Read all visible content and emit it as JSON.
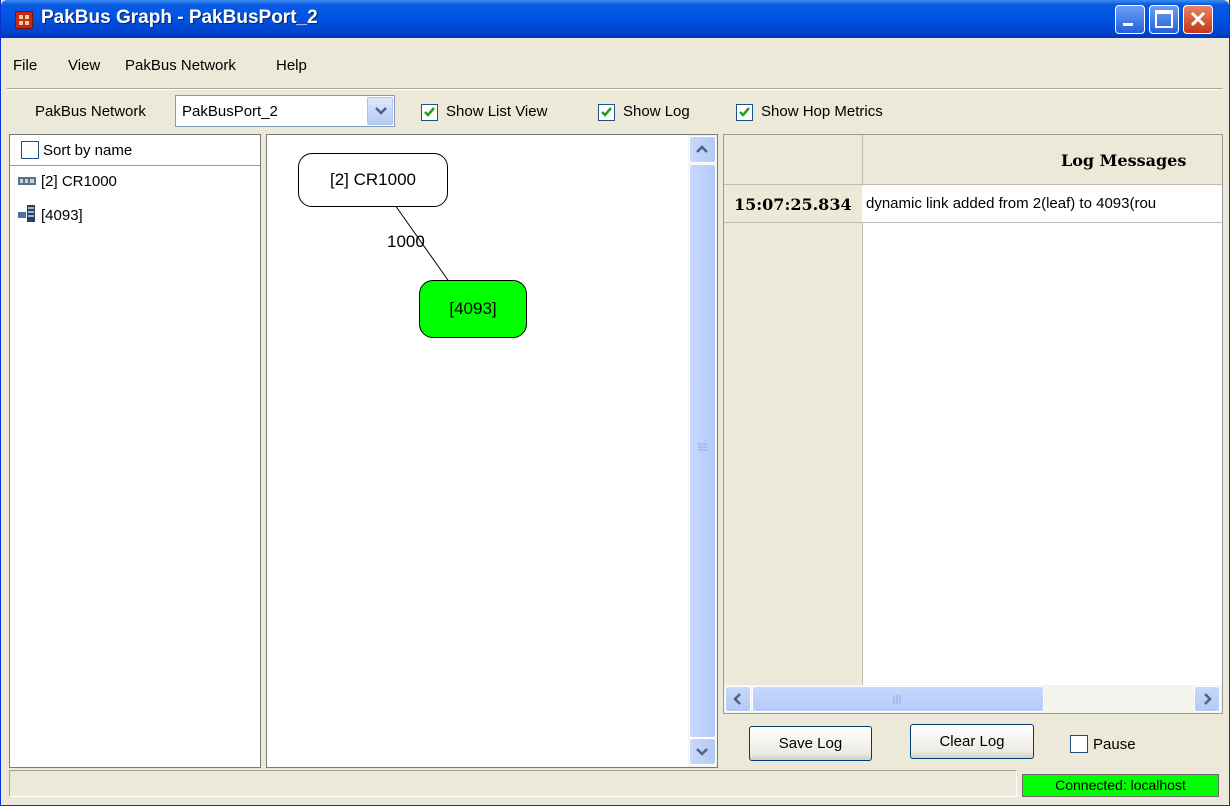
{
  "window": {
    "title": "PakBus Graph - PakBusPort_2"
  },
  "menu": [
    "File",
    "View",
    "PakBus Network",
    "Help"
  ],
  "toolbar": {
    "network_label": "PakBus Network",
    "network_value": "PakBusPort_2",
    "show_list_view": {
      "label": "Show List View",
      "checked": true
    },
    "show_log": {
      "label": "Show Log",
      "checked": true
    },
    "show_hop_metrics": {
      "label": "Show Hop Metrics",
      "checked": true
    }
  },
  "list_view": {
    "sort_by_name": {
      "label": "Sort by name",
      "checked": false
    },
    "items": [
      {
        "label": "[2] CR1000",
        "icon": "datalogger-icon"
      },
      {
        "label": "[4093]",
        "icon": "network-server-icon"
      }
    ]
  },
  "graph": {
    "nodes": [
      {
        "label": "[2] CR1000",
        "color": "#ffffff"
      },
      {
        "label": "[4093]",
        "color": "#00ff00"
      }
    ],
    "edges": [
      {
        "label": "1000"
      }
    ]
  },
  "log": {
    "header": "Log Messages",
    "rows": [
      {
        "time": "15:07:25.834",
        "message": "dynamic link added from 2(leaf) to 4093(rou"
      }
    ],
    "save_label": "Save Log",
    "clear_label": "Clear Log",
    "pause": {
      "label": "Pause",
      "checked": false
    }
  },
  "status": {
    "connection": "Connected: localhost",
    "color": "#00ff00"
  }
}
